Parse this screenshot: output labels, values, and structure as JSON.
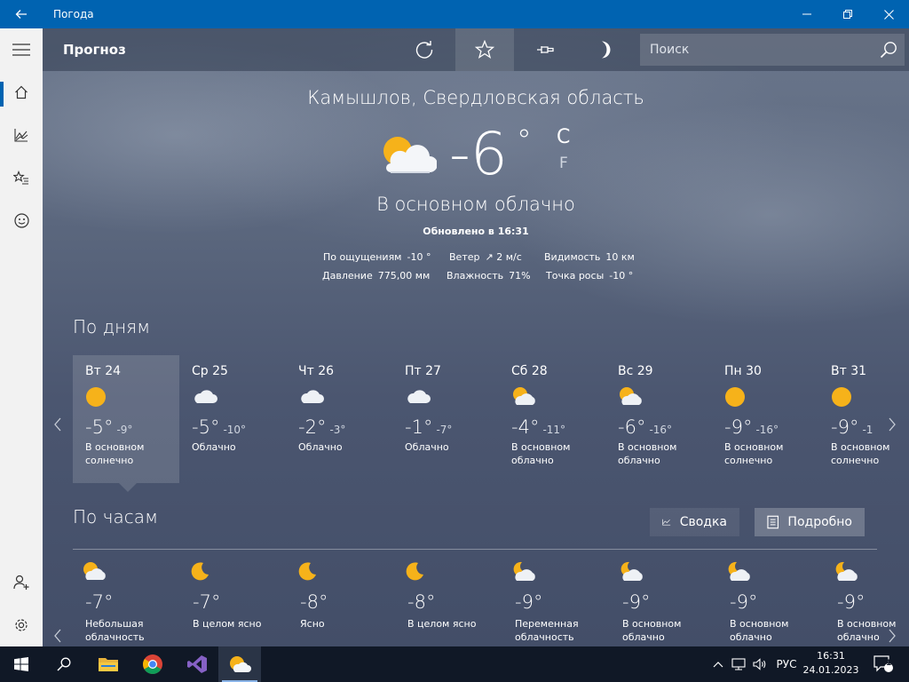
{
  "app": {
    "title": "Погода"
  },
  "command_bar": {
    "title": "Прогноз",
    "search_placeholder": "Поиск"
  },
  "current": {
    "city": "Камышлов, Свердловская область",
    "temperature": "-6",
    "degree": "°",
    "unit_c": "C",
    "unit_f": "F",
    "condition": "В основном облачно",
    "updated": "Обновлено в 16:31",
    "details": [
      {
        "label": "По ощущениям",
        "value": "-10 °"
      },
      {
        "label": "Ветер",
        "value": "↗ 2 м/с"
      },
      {
        "label": "Видимость",
        "value": "10 км"
      },
      {
        "label": "Давление",
        "value": "775,00 мм"
      },
      {
        "label": "Влажность",
        "value": "71%"
      },
      {
        "label": "Точка росы",
        "value": "-10 °"
      }
    ]
  },
  "daily": {
    "title": "По дням",
    "days": [
      {
        "name": "Вт 24",
        "icon": "sun",
        "hi": "-5°",
        "lo": "-9°",
        "cond": "В основном солнечно"
      },
      {
        "name": "Ср 25",
        "icon": "cloud",
        "hi": "-5°",
        "lo": "-10°",
        "cond": "Облачно"
      },
      {
        "name": "Чт 26",
        "icon": "cloud",
        "hi": "-2°",
        "lo": "-3°",
        "cond": "Облачно"
      },
      {
        "name": "Пт 27",
        "icon": "cloud",
        "hi": "-1°",
        "lo": "-7°",
        "cond": "Облачно"
      },
      {
        "name": "Сб 28",
        "icon": "sun-cloud",
        "hi": "-4°",
        "lo": "-11°",
        "cond": "В основном облачно"
      },
      {
        "name": "Вс 29",
        "icon": "sun-cloud",
        "hi": "-6°",
        "lo": "-16°",
        "cond": "В основном облачно"
      },
      {
        "name": "Пн 30",
        "icon": "sun",
        "hi": "-9°",
        "lo": "-16°",
        "cond": "В основном солнечно"
      },
      {
        "name": "Вт 31",
        "icon": "sun",
        "hi": "-9°",
        "lo": "-1",
        "cond": "В основном солнечно"
      }
    ]
  },
  "hourly": {
    "title": "По часам",
    "summary_label": "Сводка",
    "details_label": "Подробно",
    "hours": [
      {
        "icon": "sun-cloud",
        "temp": "-7°",
        "cond": "Небольшая облачность"
      },
      {
        "icon": "moon",
        "temp": "-7°",
        "cond": "В целом ясно"
      },
      {
        "icon": "moon",
        "temp": "-8°",
        "cond": "Ясно"
      },
      {
        "icon": "moon",
        "temp": "-8°",
        "cond": "В целом ясно"
      },
      {
        "icon": "moon-cloud",
        "temp": "-9°",
        "cond": "Переменная облачность"
      },
      {
        "icon": "moon-cloud",
        "temp": "-9°",
        "cond": "В основном облачно"
      },
      {
        "icon": "moon-cloud",
        "temp": "-9°",
        "cond": "В основном облачно"
      },
      {
        "icon": "moon-cloud",
        "temp": "-9°",
        "cond": "В основном облачно"
      }
    ]
  },
  "taskbar": {
    "language": "РУС",
    "time": "16:31",
    "date": "24.01.2023",
    "notifications": "1"
  }
}
